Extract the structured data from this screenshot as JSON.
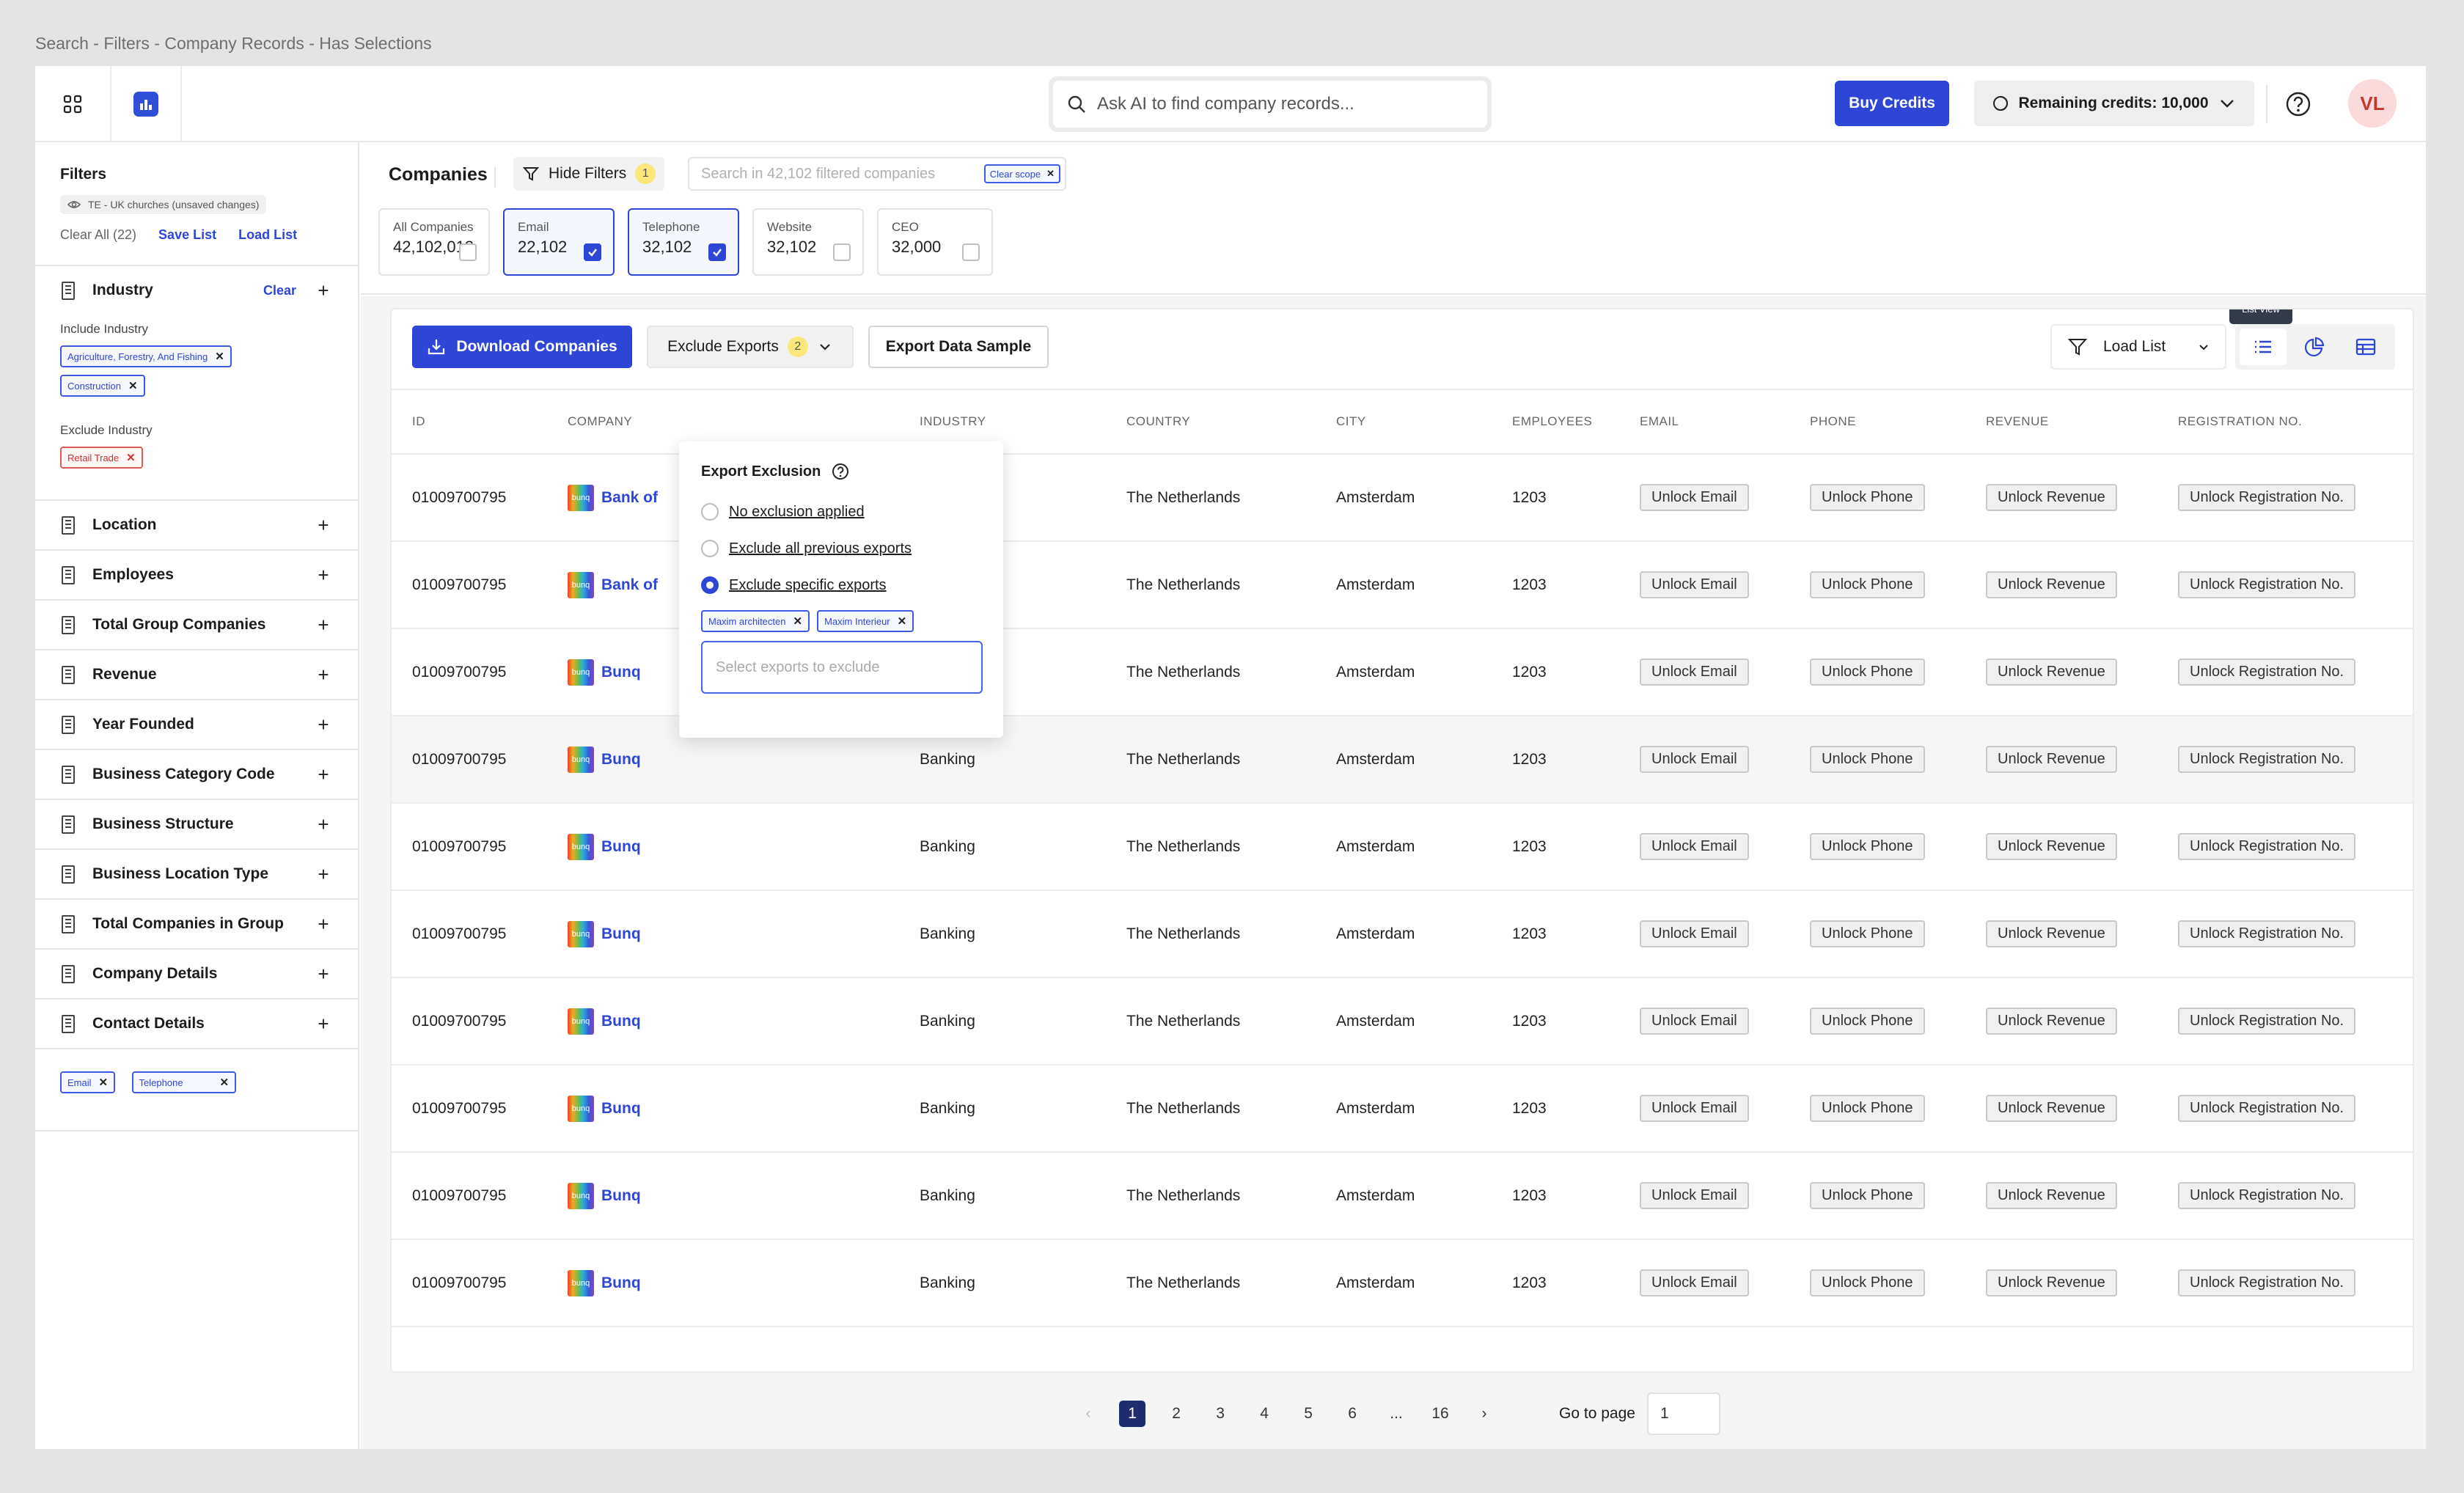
{
  "page_caption": "Search - Filters - Company Records - Has Selections",
  "topbar": {
    "search_placeholder": "Ask AI to find company records...",
    "buy_credits": "Buy Credits",
    "credits": "Remaining credits: 10,000",
    "avatar": "VL"
  },
  "sidebar": {
    "title": "Filters",
    "list_chip": "TE - UK churches (unsaved changes)",
    "clear_all": "Clear All (22)",
    "save_list": "Save List",
    "load_list": "Load List",
    "industry": {
      "title": "Industry",
      "clear": "Clear",
      "include_label": "Include Industry",
      "include": [
        "Agriculture, Forestry, And Fishing",
        "Construction"
      ],
      "exclude_label": "Exclude Industry",
      "exclude": [
        "Retail Trade"
      ]
    },
    "sections": [
      "Location",
      "Employees",
      "Total Group Companies",
      "Revenue",
      "Year Founded",
      "Business Category Code",
      "Business Structure",
      "Business Location Type",
      "Total Companies in Group",
      "Company Details",
      "Contact Details"
    ],
    "contact_tags": [
      "Email",
      "Telephone"
    ]
  },
  "main": {
    "title": "Companies",
    "hide_filters": "Hide Filters",
    "hide_filters_count": "1",
    "filter_search_placeholder": "Search in 42,102 filtered companies",
    "clear_scope": "Clear scope",
    "stats": [
      {
        "label": "All Companies",
        "value": "42,102,013",
        "selected": false
      },
      {
        "label": "Email",
        "value": "22,102",
        "selected": true
      },
      {
        "label": "Telephone",
        "value": "32,102",
        "selected": true
      },
      {
        "label": "Website",
        "value": "32,102",
        "selected": false
      },
      {
        "label": "CEO",
        "value": "32,000",
        "selected": false
      }
    ],
    "toolbar": {
      "download": "Download Companies",
      "exclude_exports": "Exclude Exports",
      "exclude_count": "2",
      "export_sample": "Export Data Sample",
      "load_list": "Load List",
      "tooltip": "List View"
    },
    "columns": [
      "ID",
      "COMPANY",
      "INDUSTRY",
      "COUNTRY",
      "CITY",
      "EMPLOYEES",
      "EMAIL",
      "PHONE",
      "REVENUE",
      "REGISTRATION NO."
    ],
    "row": {
      "id": "01009700795",
      "logo": "bunq",
      "industry": "Banking",
      "country": "The Netherlands",
      "city": "Amsterdam",
      "employees": "1203",
      "email": "Unlock Email",
      "phone": "Unlock Phone",
      "revenue": "Unlock Revenue",
      "reg": "Unlock Registration No."
    },
    "rows_company": [
      "Bank of",
      "Bank of",
      "Bunq",
      "Bunq",
      "Bunq",
      "Bunq",
      "Bunq",
      "Bunq",
      "Bunq",
      "Bunq"
    ],
    "popup": {
      "title": "Export Exclusion",
      "options": [
        "No exclusion applied",
        "Exclude all previous exports",
        "Exclude specific exports"
      ],
      "selected_option": 2,
      "tags": [
        "Maxim architecten",
        "Maxim Interieur"
      ],
      "input_placeholder": "Select exports to exclude"
    },
    "pagination": {
      "pages": [
        "1",
        "2",
        "3",
        "4",
        "5",
        "6",
        "...",
        "16"
      ],
      "current": "1",
      "goto_label": "Go to page",
      "goto_value": "1"
    }
  }
}
